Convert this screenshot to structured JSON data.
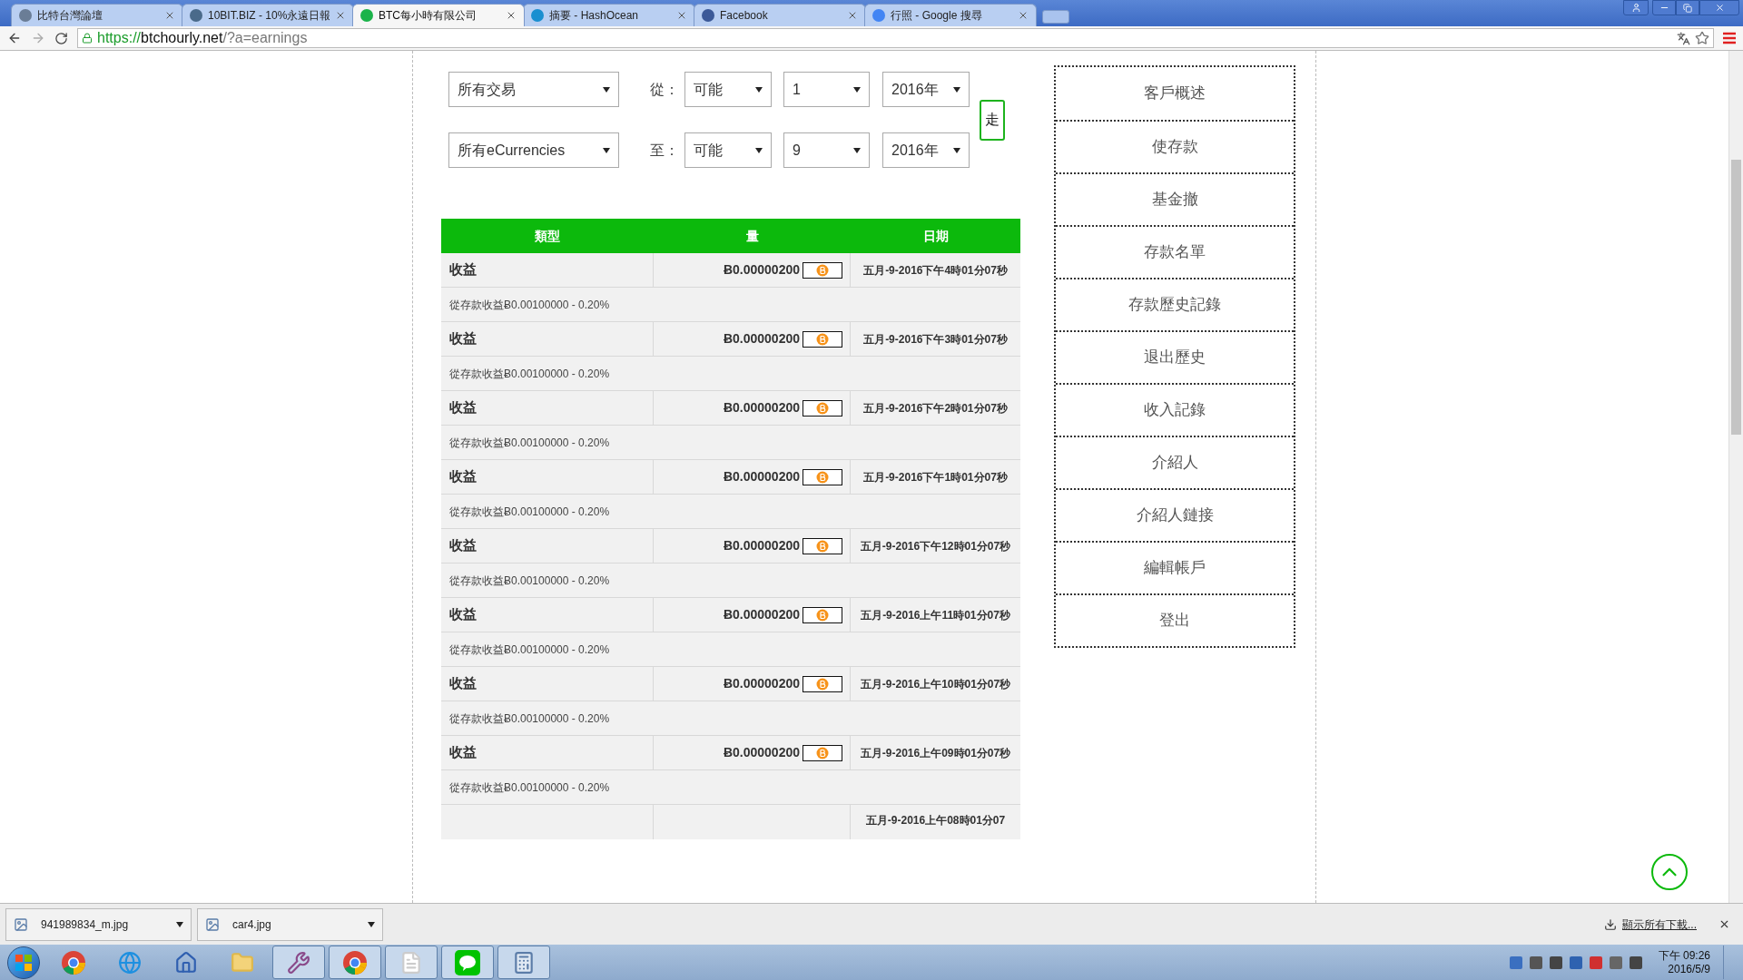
{
  "browser": {
    "tabs": [
      {
        "title": "比特台灣論壇",
        "selected": false
      },
      {
        "title": "10BIT.BIZ - 10%永遠日報",
        "selected": false
      },
      {
        "title": "BTC每小時有限公司",
        "selected": true
      },
      {
        "title": "摘要 - HashOcean",
        "selected": false
      },
      {
        "title": "Facebook",
        "selected": false
      },
      {
        "title": "行照 - Google 搜尋",
        "selected": false
      }
    ],
    "url": {
      "scheme": "https://",
      "host": "btchourly.net",
      "path": "/?a=earnings"
    }
  },
  "filters": {
    "rows": [
      {
        "currency": "所有交易",
        "label": "從：",
        "period": "可能",
        "day": "1",
        "year": "2016年"
      },
      {
        "currency": "所有eCurrencies",
        "label": "至：",
        "period": "可能",
        "day": "9",
        "year": "2016年"
      }
    ],
    "go_button": "走"
  },
  "table": {
    "columns": [
      "類型",
      "量",
      "日期"
    ],
    "rows": [
      {
        "type": "收益",
        "amount": "Ƀ0.00000200",
        "date": "五月-9-2016下午4時01分07秒",
        "note": "從存款收益Ƀ0.00100000 - 0.20%"
      },
      {
        "type": "收益",
        "amount": "Ƀ0.00000200",
        "date": "五月-9-2016下午3時01分07秒",
        "note": "從存款收益Ƀ0.00100000 - 0.20%"
      },
      {
        "type": "收益",
        "amount": "Ƀ0.00000200",
        "date": "五月-9-2016下午2時01分07秒",
        "note": "從存款收益Ƀ0.00100000 - 0.20%"
      },
      {
        "type": "收益",
        "amount": "Ƀ0.00000200",
        "date": "五月-9-2016下午1時01分07秒",
        "note": "從存款收益Ƀ0.00100000 - 0.20%"
      },
      {
        "type": "收益",
        "amount": "Ƀ0.00000200",
        "date": "五月-9-2016下午12時01分07秒",
        "note": "從存款收益Ƀ0.00100000 - 0.20%"
      },
      {
        "type": "收益",
        "amount": "Ƀ0.00000200",
        "date": "五月-9-2016上午11時01分07秒",
        "note": "從存款收益Ƀ0.00100000 - 0.20%"
      },
      {
        "type": "收益",
        "amount": "Ƀ0.00000200",
        "date": "五月-9-2016上午10時01分07秒",
        "note": "從存款收益Ƀ0.00100000 - 0.20%"
      },
      {
        "type": "收益",
        "amount": "Ƀ0.00000200",
        "date": "五月-9-2016上午09時01分07秒",
        "note": "從存款收益Ƀ0.00100000 - 0.20%"
      }
    ],
    "cut_row_date": "五月-9-2016上午08時01分07"
  },
  "sidebar": {
    "items": [
      "客戶概述",
      "使存款",
      "基金撤",
      "存款名單",
      "存款歷史記錄",
      "退出歷史",
      "收入記錄",
      "介紹人",
      "介紹人鏈接",
      "編輯帳戶",
      "登出"
    ]
  },
  "downloads": {
    "files": [
      "941989834_m.jpg",
      "car4.jpg"
    ],
    "show_all": "顯示所有下載..."
  },
  "taskbar": {
    "apps": [
      {
        "kind": "chrome",
        "open": false
      },
      {
        "kind": "ie",
        "open": false
      },
      {
        "kind": "home",
        "open": false
      },
      {
        "kind": "folder",
        "open": false
      },
      {
        "kind": "tool",
        "open": true
      },
      {
        "kind": "chrome",
        "open": true
      },
      {
        "kind": "file",
        "open": true
      },
      {
        "kind": "line",
        "open": true
      },
      {
        "kind": "calculator",
        "open": true
      }
    ],
    "time": "下午 09:26",
    "date": "2016/5/9"
  }
}
